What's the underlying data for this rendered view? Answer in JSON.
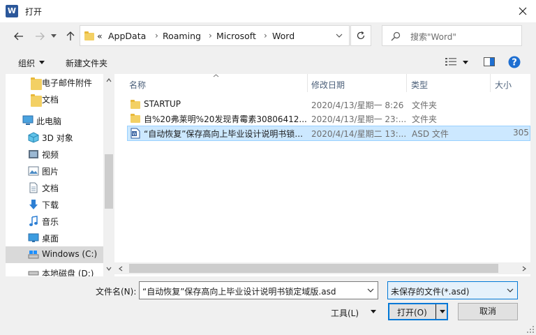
{
  "window": {
    "title": "打开",
    "app_icon_letter": "W"
  },
  "nav": {
    "address_crumbs": [
      "AppData",
      "Roaming",
      "Microsoft",
      "Word"
    ],
    "address_prefix": "«",
    "search_placeholder": "搜索\"Word\""
  },
  "toolbar": {
    "organize_label": "组织",
    "new_folder_label": "新建文件夹"
  },
  "sidebar": {
    "items": [
      {
        "label": "电子邮件附件",
        "icon": "folder-icon"
      },
      {
        "label": "文档",
        "icon": "folder-icon"
      },
      {
        "label": "此电脑",
        "icon": "computer-icon"
      },
      {
        "label": "3D 对象",
        "icon": "cube-icon"
      },
      {
        "label": "视频",
        "icon": "video-icon"
      },
      {
        "label": "图片",
        "icon": "picture-icon"
      },
      {
        "label": "文档",
        "icon": "document-icon"
      },
      {
        "label": "下载",
        "icon": "download-icon"
      },
      {
        "label": "音乐",
        "icon": "music-icon"
      },
      {
        "label": "桌面",
        "icon": "desktop-icon"
      },
      {
        "label": "Windows (C:)",
        "icon": "drive-icon"
      },
      {
        "label": "本地磁盘 (D:)",
        "icon": "drive-icon"
      }
    ]
  },
  "list": {
    "headers": {
      "name": "名称",
      "date": "修改日期",
      "type": "类型",
      "size": "大小"
    },
    "rows": [
      {
        "name": "STARTUP",
        "date": "2020/4/13/星期一 8:26",
        "type": "文件夹",
        "size": ""
      },
      {
        "name": "自%20弗莱明%20发现青霉素30806412...",
        "date": "2020/4/13/星期一 23:...",
        "type": "文件夹",
        "size": ""
      },
      {
        "name": "“自动恢复”保存高向上毕业设计说明书锁...",
        "date": "2020/4/14/星期二 13:...",
        "type": "ASD 文件",
        "size": "305"
      }
    ]
  },
  "bottom": {
    "filename_label": "文件名(N):",
    "filename_value": "“自动恢复”保存高向上毕业设计说明书锁定域版.asd",
    "filter_value": "未保存的文件(*.asd)",
    "tools_label": "工具(L)",
    "open_label": "打开(O)",
    "cancel_label": "取消"
  },
  "colors": {
    "accent": "#0078d7",
    "selection": "#cce8ff",
    "help": "#1f6fd1",
    "folder": "#f3d064"
  }
}
